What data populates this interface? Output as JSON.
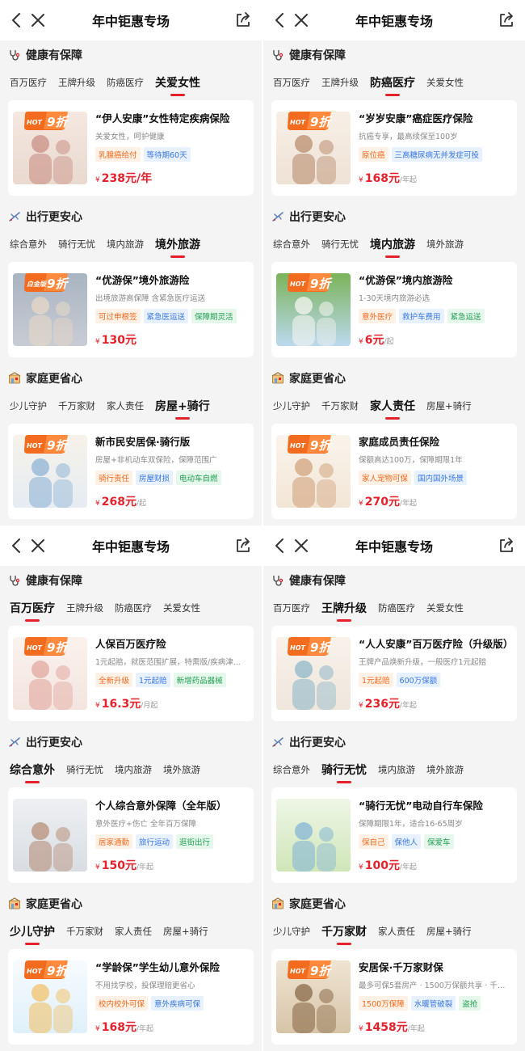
{
  "panels": [
    {
      "title": "年中钜惠专场",
      "sections": [
        {
          "heading": "健康有保障",
          "icon": "stethoscope-icon",
          "tabs": [
            "百万医疗",
            "王牌升级",
            "防癌医疗",
            "关爱女性"
          ],
          "active": 3,
          "card": {
            "badge": "9折",
            "badge_tag": "HOT",
            "name": "“伊人安康”女性特定疾病保险",
            "desc": "关爱女性，呵护健康",
            "chips": [
              "乳腺癌给付",
              "等待期60天"
            ],
            "chip_colors": [
              0,
              1
            ],
            "yen": "¥",
            "price": "238元/年",
            "unit": "",
            "photo": "women-flowers"
          }
        },
        {
          "heading": "出行更安心",
          "icon": "airplane-icon",
          "tabs": [
            "综合意外",
            "骑行无忧",
            "境内旅游",
            "境外旅游"
          ],
          "active": 3,
          "card": {
            "badge": "9折",
            "badge_tag": "白金版",
            "name": "“优游保”境外旅游险",
            "desc": "出境旅游高保障 含紧急医疗运送",
            "chips": [
              "可过申根签",
              "紧急医运送",
              "保障期灵活"
            ],
            "chip_colors": [
              0,
              1,
              2
            ],
            "yen": "¥",
            "price": "130元",
            "unit": "",
            "photo": "family-city"
          }
        },
        {
          "heading": "家庭更省心",
          "icon": "house-icon",
          "tabs": [
            "少儿守护",
            "千万家财",
            "家人责任",
            "房屋+骑行"
          ],
          "active": 3,
          "card": {
            "badge": "9折",
            "badge_tag": "HOT",
            "name": "新市民安居保·骑行版",
            "desc": "房屋+非机动车双保险，保障范围广",
            "chips": [
              "骑行责任",
              "房屋财损",
              "电动车自燃"
            ],
            "chip_colors": [
              0,
              1,
              2
            ],
            "yen": "¥",
            "price": "268元",
            "unit": "/起",
            "photo": "scooter-woman"
          }
        }
      ]
    },
    {
      "title": "年中钜惠专场",
      "sections": [
        {
          "heading": "健康有保障",
          "icon": "stethoscope-icon",
          "tabs": [
            "百万医疗",
            "王牌升级",
            "防癌医疗",
            "关爱女性"
          ],
          "active": 2,
          "card": {
            "badge": "9折",
            "badge_tag": "HOT",
            "name": "“岁岁安康”癌症医疗保险",
            "desc": "抗癌专享，最高续保至100岁",
            "chips": [
              "原位癌",
              "三高糖尿病无并发症可投"
            ],
            "chip_colors": [
              0,
              1
            ],
            "yen": "¥",
            "price": "168元",
            "unit": "/年起",
            "photo": "elderly-family"
          }
        },
        {
          "heading": "出行更安心",
          "icon": "airplane-icon",
          "tabs": [
            "综合意外",
            "骑行无忧",
            "境内旅游",
            "境外旅游"
          ],
          "active": 2,
          "card": {
            "badge": "9折",
            "badge_tag": "HOT",
            "name": "“优游保”境内旅游险",
            "desc": "1-30天境内旅游必选",
            "chips": [
              "意外医疗",
              "救护车费用",
              "紧急运送"
            ],
            "chip_colors": [
              0,
              1,
              2
            ],
            "yen": "¥",
            "price": "6元",
            "unit": "/起",
            "photo": "camping"
          }
        },
        {
          "heading": "家庭更省心",
          "icon": "house-icon",
          "tabs": [
            "少儿守护",
            "千万家财",
            "家人责任",
            "房屋+骑行"
          ],
          "active": 2,
          "card": {
            "badge": "9折",
            "badge_tag": "HOT",
            "name": "家庭成员责任保险",
            "desc": "保额高达100万，保障期限1年",
            "chips": [
              "家人宠物可保",
              "国内国外场景"
            ],
            "chip_colors": [
              0,
              1
            ],
            "yen": "¥",
            "price": "270元",
            "unit": "/年起",
            "photo": "family-hug"
          }
        }
      ]
    },
    {
      "title": "年中钜惠专场",
      "sections": [
        {
          "heading": "健康有保障",
          "icon": "stethoscope-icon",
          "tabs": [
            "百万医疗",
            "王牌升级",
            "防癌医疗",
            "关爱女性"
          ],
          "active": 0,
          "card": {
            "badge": "9折",
            "badge_tag": "HOT",
            "name": "人保百万医疗险",
            "desc": "1元起赔，就医范围扩展，特需版/疾病津...",
            "chips": [
              "全新升级",
              "1元起赔",
              "新增药品器械"
            ],
            "chip_colors": [
              0,
              1,
              2
            ],
            "yen": "¥",
            "price": "16.3元",
            "unit": "/月起",
            "photo": "mother-daughter"
          }
        },
        {
          "heading": "出行更安心",
          "icon": "airplane-icon",
          "tabs": [
            "综合意外",
            "骑行无忧",
            "境内旅游",
            "境外旅游"
          ],
          "active": 0,
          "card": {
            "badge": "",
            "badge_tag": "",
            "name": "个人综合意外保障（全年版）",
            "desc": "意外医疗+伤亡 全年百万保障",
            "chips": [
              "居家通勤",
              "旅行运动",
              "逛街出行"
            ],
            "chip_colors": [
              0,
              1,
              2
            ],
            "yen": "¥",
            "price": "150元",
            "unit": "/年起",
            "photo": "two-women"
          }
        },
        {
          "heading": "家庭更省心",
          "icon": "house-icon",
          "tabs": [
            "少儿守护",
            "千万家财",
            "家人责任",
            "房屋+骑行"
          ],
          "active": 0,
          "card": {
            "badge": "9折",
            "badge_tag": "HOT",
            "name": "“学龄保”学生幼儿意外保险",
            "desc": "不用找学校，投保理赔更省心",
            "chips": [
              "校内校外可保",
              "意外疾病可保"
            ],
            "chip_colors": [
              0,
              1
            ],
            "yen": "¥",
            "price": "168元",
            "unit": "/年起",
            "photo": "kids"
          }
        }
      ]
    },
    {
      "title": "年中钜惠专场",
      "sections": [
        {
          "heading": "健康有保障",
          "icon": "stethoscope-icon",
          "tabs": [
            "百万医疗",
            "王牌升级",
            "防癌医疗",
            "关爱女性"
          ],
          "active": 1,
          "card": {
            "badge": "9折",
            "badge_tag": "HOT",
            "name": "“人人安康”百万医疗险（升级版）",
            "desc": "王牌产品焕新升级，一般医疗1元起赔",
            "chips": [
              "1元起赔",
              "600万保额"
            ],
            "chip_colors": [
              0,
              1
            ],
            "yen": "¥",
            "price": "236元",
            "unit": "/年起",
            "photo": "mother-child"
          }
        },
        {
          "heading": "出行更安心",
          "icon": "airplane-icon",
          "tabs": [
            "综合意外",
            "骑行无忧",
            "境内旅游",
            "境外旅游"
          ],
          "active": 1,
          "card": {
            "badge": "",
            "badge_tag": "",
            "name": "“骑行无忧”电动自行车保险",
            "desc": "保障期限1年，适合16-65周岁",
            "chips": [
              "保自己",
              "保他人",
              "保爱车"
            ],
            "chip_colors": [
              0,
              1,
              2
            ],
            "yen": "¥",
            "price": "100元",
            "unit": "/年起",
            "photo": "ebike"
          }
        },
        {
          "heading": "家庭更省心",
          "icon": "house-icon",
          "tabs": [
            "少儿守护",
            "千万家财",
            "家人责任",
            "房屋+骑行"
          ],
          "active": 1,
          "card": {
            "badge": "9折",
            "badge_tag": "HOT",
            "name": "安居保·千万家财保",
            "desc": "最多可保5套房产 · 1500万保额共享 · 千万...",
            "chips": [
              "1500万保障",
              "水暖管破裂",
              "盗抢"
            ],
            "chip_colors": [
              0,
              1,
              2
            ],
            "yen": "¥",
            "price": "1458元",
            "unit": "/年起",
            "photo": "insurance-house"
          }
        }
      ]
    }
  ],
  "colors": {
    "accent": "#e5212b",
    "background": "#f4f4f4",
    "chip_orange": "#f06a1e",
    "chip_blue": "#3a78e0",
    "chip_green": "#22a052"
  }
}
